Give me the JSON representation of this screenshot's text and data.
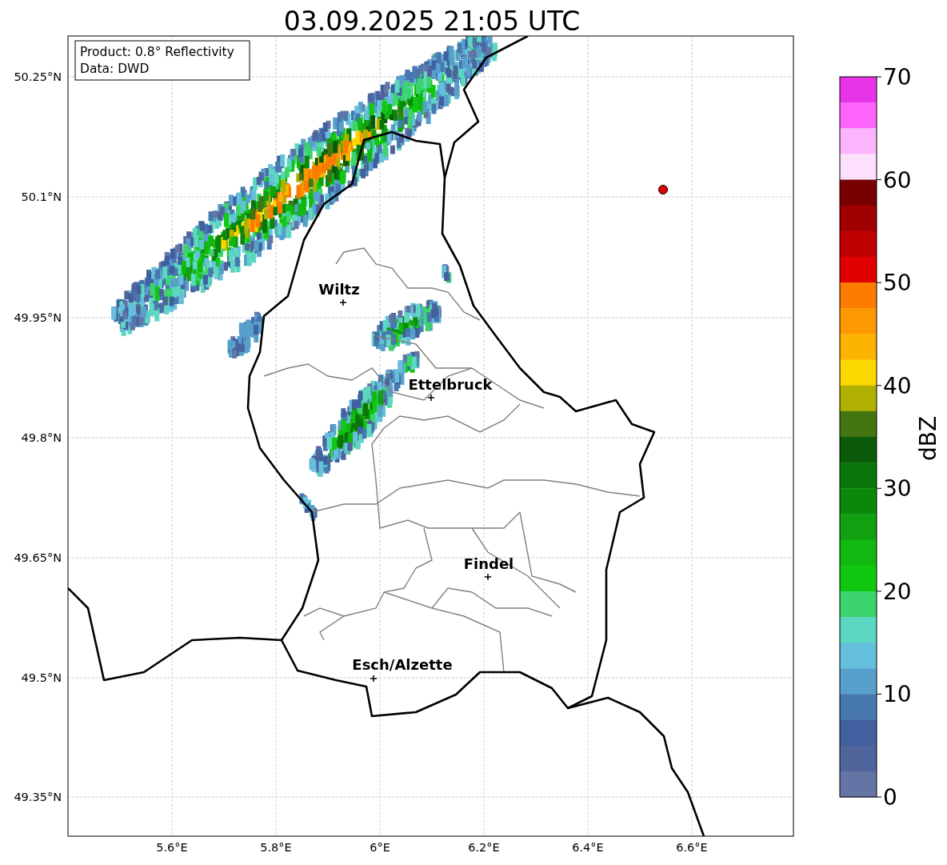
{
  "title": "03.09.2025 21:05 UTC",
  "info_box": [
    "Product: 0.8° Reflectivity",
    "Data: DWD"
  ],
  "y_ticks": [
    "50.25°N",
    "50.1°N",
    "49.95°N",
    "49.8°N",
    "49.65°N",
    "49.5°N",
    "49.35°N"
  ],
  "x_ticks": [
    "5.6°E",
    "5.8°E",
    "6°E",
    "6.2°E",
    "6.4°E",
    "6.6°E"
  ],
  "cities": [
    {
      "name": "Wiltz"
    },
    {
      "name": "Ettelbruck"
    },
    {
      "name": "Findel"
    },
    {
      "name": "Esch/Alzette"
    }
  ],
  "colorbar": {
    "label": "dBZ",
    "ticks": [
      "70",
      "60",
      "50",
      "40",
      "30",
      "20",
      "10",
      "0"
    ],
    "segments": [
      {
        "color": "#e833e8"
      },
      {
        "color": "#fc64fc"
      },
      {
        "color": "#fcb4fc"
      },
      {
        "color": "#fce0fc"
      },
      {
        "color": "#780000"
      },
      {
        "color": "#a00000"
      },
      {
        "color": "#c00000"
      },
      {
        "color": "#e00000"
      },
      {
        "color": "#fc7c00"
      },
      {
        "color": "#fc9800"
      },
      {
        "color": "#fcb400"
      },
      {
        "color": "#fcd800"
      },
      {
        "color": "#b0b000"
      },
      {
        "color": "#437510"
      },
      {
        "color": "#0a5a0a"
      },
      {
        "color": "#0a760a"
      },
      {
        "color": "#0a880a"
      },
      {
        "color": "#10a010"
      },
      {
        "color": "#10b810"
      },
      {
        "color": "#10c810"
      },
      {
        "color": "#3cd46c"
      },
      {
        "color": "#5cd8c0"
      },
      {
        "color": "#64c0dc"
      },
      {
        "color": "#58a0cc"
      },
      {
        "color": "#4878b0"
      },
      {
        "color": "#4060a0"
      },
      {
        "color": "#50649c"
      },
      {
        "color": "#6474a4"
      }
    ]
  }
}
